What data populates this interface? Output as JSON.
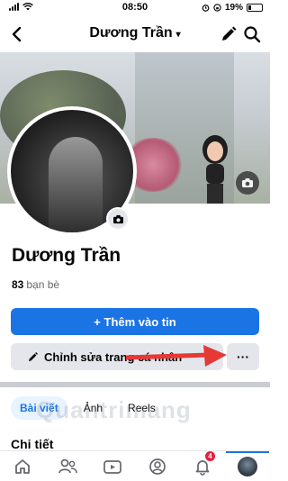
{
  "status_bar": {
    "time": "08:50",
    "battery": "19%"
  },
  "header": {
    "title": "Dương Trần",
    "caret": "▾"
  },
  "profile": {
    "name": "Dương Trần",
    "friends_count": "83",
    "friends_label": "bạn bè"
  },
  "actions": {
    "add_story": "+ Thêm vào tin",
    "edit_profile": "Chỉnh sửa trang cá nhân",
    "more": "···"
  },
  "tabs": [
    {
      "label": "Bài viết",
      "active": true
    },
    {
      "label": "Ảnh",
      "active": false
    },
    {
      "label": "Reels",
      "active": false
    }
  ],
  "section": {
    "title": "Chi tiết"
  },
  "watermark": "Quantrimang",
  "bottom_nav": {
    "items": [
      "home-icon",
      "friends-icon",
      "video-icon",
      "profile-icon",
      "bell-icon",
      "avatar"
    ],
    "notification_badge": "4"
  },
  "colors": {
    "accent": "#1b74e4",
    "badge": "#e41e3f",
    "button_gray": "#e4e6eb",
    "arrow": "#e53935"
  }
}
